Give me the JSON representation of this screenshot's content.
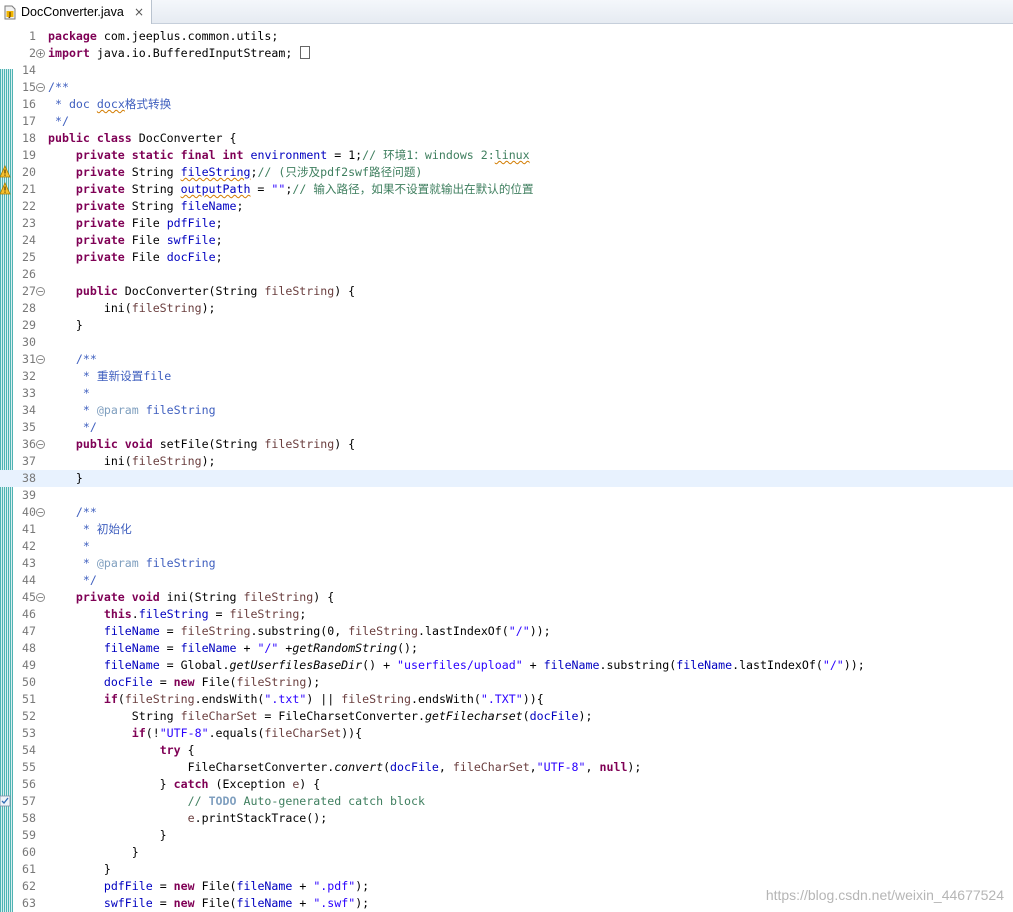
{
  "tab": {
    "title": "DocConverter.java",
    "close_glyph": "×",
    "icon": "java-file-icon"
  },
  "editor": {
    "lines": [
      {
        "n": "1",
        "code": "package com.jeeplus.common.utils;"
      },
      {
        "n": "2",
        "code": "import java.io.BufferedInputStream;",
        "fold": "plus"
      },
      {
        "n": "14",
        "code": ""
      },
      {
        "n": "15",
        "code": "/**",
        "fold": "minus"
      },
      {
        "n": "16",
        "code": " * doc docx格式转换"
      },
      {
        "n": "17",
        "code": " */"
      },
      {
        "n": "18",
        "code": "public class DocConverter {"
      },
      {
        "n": "19",
        "code": "    private static final int environment = 1;// 环境1：windows 2:linux"
      },
      {
        "n": "20",
        "code": "    private String fileString;// (只涉及pdf2swf路径问题)",
        "warning": true
      },
      {
        "n": "21",
        "code": "    private String outputPath = \"\";// 输入路径，如果不设置就输出在默认的位置",
        "warning": true
      },
      {
        "n": "22",
        "code": "    private String fileName;"
      },
      {
        "n": "23",
        "code": "    private File pdfFile;"
      },
      {
        "n": "24",
        "code": "    private File swfFile;"
      },
      {
        "n": "25",
        "code": "    private File docFile;"
      },
      {
        "n": "26",
        "code": ""
      },
      {
        "n": "27",
        "code": "    public DocConverter(String fileString) {",
        "fold": "minus"
      },
      {
        "n": "28",
        "code": "        ini(fileString);"
      },
      {
        "n": "29",
        "code": "    }"
      },
      {
        "n": "30",
        "code": ""
      },
      {
        "n": "31",
        "code": "    /**",
        "fold": "minus"
      },
      {
        "n": "32",
        "code": "     * 重新设置file"
      },
      {
        "n": "33",
        "code": "     *"
      },
      {
        "n": "34",
        "code": "     * @param fileString"
      },
      {
        "n": "35",
        "code": "     */"
      },
      {
        "n": "36",
        "code": "    public void setFile(String fileString) {",
        "fold": "minus"
      },
      {
        "n": "37",
        "code": "        ini(fileString);"
      },
      {
        "n": "38",
        "code": "    }",
        "current": true
      },
      {
        "n": "39",
        "code": ""
      },
      {
        "n": "40",
        "code": "    /**",
        "fold": "minus"
      },
      {
        "n": "41",
        "code": "     * 初始化"
      },
      {
        "n": "42",
        "code": "     *"
      },
      {
        "n": "43",
        "code": "     * @param fileString"
      },
      {
        "n": "44",
        "code": "     */"
      },
      {
        "n": "45",
        "code": "    private void ini(String fileString) {",
        "fold": "minus"
      },
      {
        "n": "46",
        "code": "        this.fileString = fileString;"
      },
      {
        "n": "47",
        "code": "        fileName = fileString.substring(0, fileString.lastIndexOf(\"/\"));"
      },
      {
        "n": "48",
        "code": "        fileName = fileName + \"/\" +getRandomString();"
      },
      {
        "n": "49",
        "code": "        fileName = Global.getUserfilesBaseDir() + \"userfiles/upload\" + fileName.substring(fileName.lastIndexOf(\"/\"));"
      },
      {
        "n": "50",
        "code": "        docFile = new File(fileString);"
      },
      {
        "n": "51",
        "code": "        if(fileString.endsWith(\".txt\") || fileString.endsWith(\".TXT\")){"
      },
      {
        "n": "52",
        "code": "            String fileCharSet = FileCharsetConverter.getFilecharset(docFile);"
      },
      {
        "n": "53",
        "code": "            if(!\"UTF-8\".equals(fileCharSet)){"
      },
      {
        "n": "54",
        "code": "                try {"
      },
      {
        "n": "55",
        "code": "                    FileCharsetConverter.convert(docFile, fileCharSet,\"UTF-8\", null);"
      },
      {
        "n": "56",
        "code": "                } catch (Exception e) {"
      },
      {
        "n": "57",
        "code": "                    // TODO Auto-generated catch block",
        "task": true
      },
      {
        "n": "58",
        "code": "                    e.printStackTrace();"
      },
      {
        "n": "59",
        "code": "                }"
      },
      {
        "n": "60",
        "code": "            }"
      },
      {
        "n": "61",
        "code": "        }"
      },
      {
        "n": "62",
        "code": "        pdfFile = new File(fileName + \".pdf\");"
      },
      {
        "n": "63",
        "code": "        swfFile = new File(fileName + \".swf\");"
      }
    ]
  },
  "watermark": "https://blog.csdn.net/weixin_44677524",
  "colors": {
    "keyword": "#7f0055",
    "field": "#0000c0",
    "parameter": "#6a3e3e",
    "string": "#2a00ff",
    "comment": "#3f7f5f",
    "javadoc": "#3f5fbf",
    "javadoc_tag": "#7f9fbf",
    "current_line": "#e8f2fe",
    "line_number": "#787878"
  }
}
